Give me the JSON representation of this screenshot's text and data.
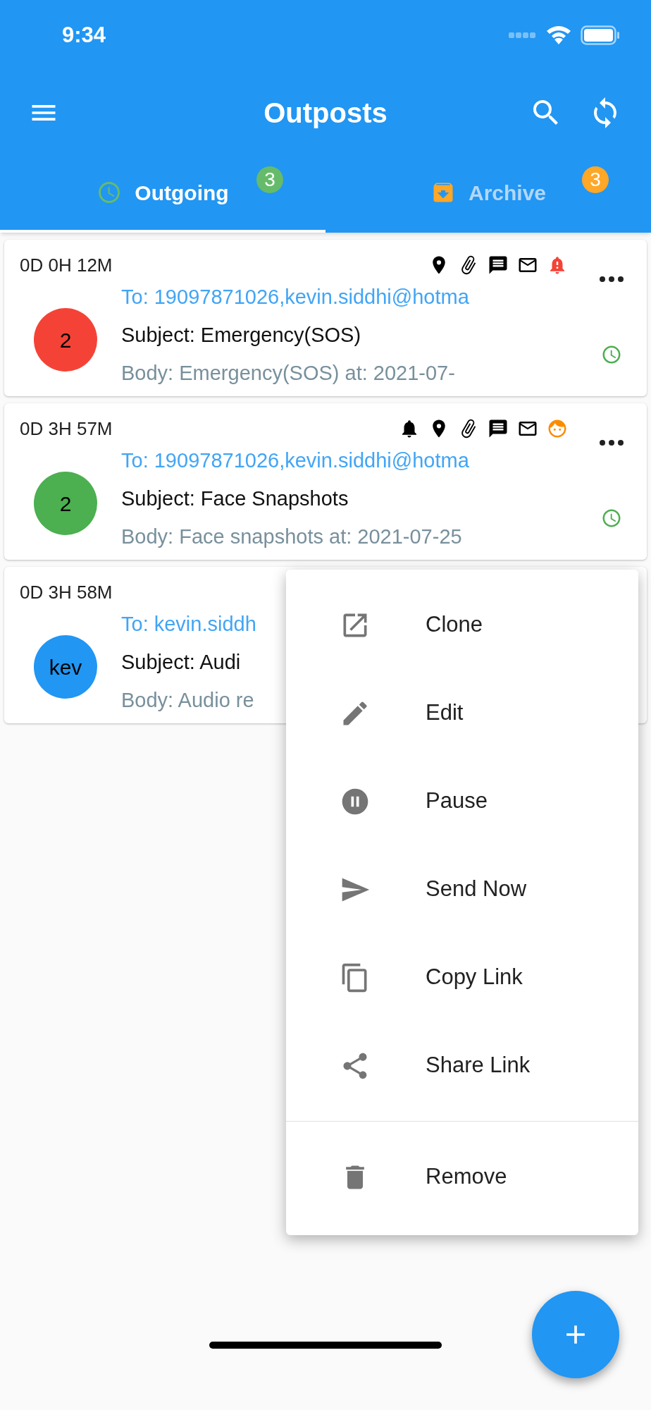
{
  "status_bar": {
    "time": "9:34"
  },
  "app_bar": {
    "title": "Outposts"
  },
  "tabs": [
    {
      "label": "Outgoing",
      "selected": true,
      "kind": "outgoing",
      "badge": "3",
      "color": "#66bb6a"
    },
    {
      "label": "Archive",
      "selected": false,
      "kind": "archive",
      "badge": "3",
      "color": "#ffa726"
    }
  ],
  "cards": [
    {
      "elapsed": "0D 0H 12M",
      "avatar": "2",
      "color": "#f44336",
      "to": "To: 19097871026,kevin.siddhi@hotma",
      "subject": "Subject: Emergency(SOS)",
      "body": "Body: Emergency(SOS) at: 2021-07-",
      "icons": [
        {
          "kind": "location"
        },
        {
          "kind": "attachment"
        },
        {
          "kind": "message"
        },
        {
          "kind": "mail"
        },
        {
          "kind": "alert"
        }
      ]
    },
    {
      "elapsed": "0D 3H 57M",
      "avatar": "2",
      "color": "#4caf50",
      "to": "To: 19097871026,kevin.siddhi@hotma",
      "subject": "Subject: Face Snapshots",
      "body": "Body: Face snapshots at: 2021-07-25",
      "icons": [
        {
          "kind": "bell"
        },
        {
          "kind": "location"
        },
        {
          "kind": "attachment"
        },
        {
          "kind": "message"
        },
        {
          "kind": "mail"
        },
        {
          "kind": "face"
        }
      ]
    },
    {
      "elapsed": "0D 3H 58M",
      "avatar": "kev",
      "color": "#2196f3",
      "to": "To: kevin.siddh",
      "subject": "Subject: Audi",
      "body": "Body: Audio re"
    }
  ],
  "menu": [
    {
      "label": "Clone",
      "kind": "clone",
      "divider_before": false
    },
    {
      "label": "Edit",
      "kind": "edit",
      "divider_before": false
    },
    {
      "label": "Pause",
      "kind": "pause",
      "divider_before": false
    },
    {
      "label": "Send Now",
      "kind": "send",
      "divider_before": false
    },
    {
      "label": "Copy Link",
      "kind": "copy",
      "divider_before": false
    },
    {
      "label": "Share Link",
      "kind": "share",
      "divider_before": false
    },
    {
      "label": "Remove",
      "kind": "remove",
      "divider_before": true
    }
  ]
}
